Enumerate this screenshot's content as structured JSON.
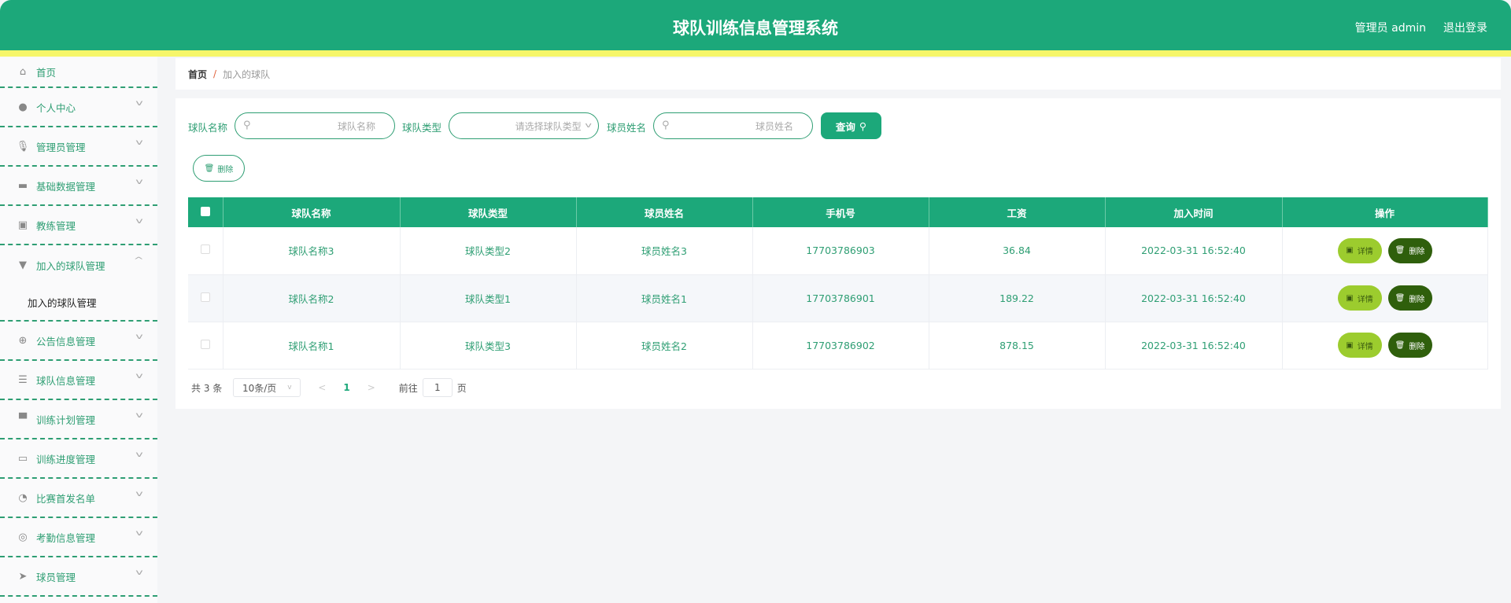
{
  "header": {
    "title": "球队训练信息管理系统",
    "user": "管理员 admin",
    "logout": "退出登录"
  },
  "sidebar": {
    "items": [
      {
        "label": "首页",
        "icon": "home-icon"
      },
      {
        "label": "个人中心",
        "icon": "user-icon"
      },
      {
        "label": "管理员管理",
        "icon": "microphone-icon"
      },
      {
        "label": "基础数据管理",
        "icon": "briefcase-icon"
      },
      {
        "label": "教练管理",
        "icon": "clipboard-icon"
      },
      {
        "label": "加入的球队管理",
        "icon": "flag-icon",
        "sub": "加入的球队管理"
      },
      {
        "label": "公告信息管理",
        "icon": "crosshair-icon"
      },
      {
        "label": "球队信息管理",
        "icon": "list-icon"
      },
      {
        "label": "训练计划管理",
        "icon": "monitor-icon"
      },
      {
        "label": "训练进度管理",
        "icon": "card-icon"
      },
      {
        "label": "比赛首发名单",
        "icon": "gauge-icon"
      },
      {
        "label": "考勤信息管理",
        "icon": "lifebuoy-icon"
      },
      {
        "label": "球员管理",
        "icon": "send-icon"
      }
    ]
  },
  "breadcrumb": {
    "home": "首页",
    "sep": "/",
    "current": "加入的球队"
  },
  "search": {
    "team_name_label": "球队名称",
    "team_name_placeholder": "球队名称",
    "team_type_label": "球队类型",
    "team_type_placeholder": "请选择球队类型",
    "player_name_label": "球员姓名",
    "player_name_placeholder": "球员姓名",
    "query": "查询",
    "delete": "删除"
  },
  "table": {
    "columns": [
      "球队名称",
      "球队类型",
      "球员姓名",
      "手机号",
      "工资",
      "加入时间",
      "操作"
    ],
    "rows": [
      [
        "球队名称3",
        "球队类型2",
        "球员姓名3",
        "17703786903",
        "36.84",
        "2022-03-31 16:52:40"
      ],
      [
        "球队名称2",
        "球队类型1",
        "球员姓名1",
        "17703786901",
        "189.22",
        "2022-03-31 16:52:40"
      ],
      [
        "球队名称1",
        "球队类型3",
        "球员姓名2",
        "17703786902",
        "878.15",
        "2022-03-31 16:52:40"
      ]
    ],
    "detail": "详情",
    "delete": "删除"
  },
  "pagination": {
    "total": "共 3 条",
    "page_size": "10条/页",
    "current": "1",
    "goto": "前往",
    "goto_value": "1",
    "page_unit": "页"
  }
}
